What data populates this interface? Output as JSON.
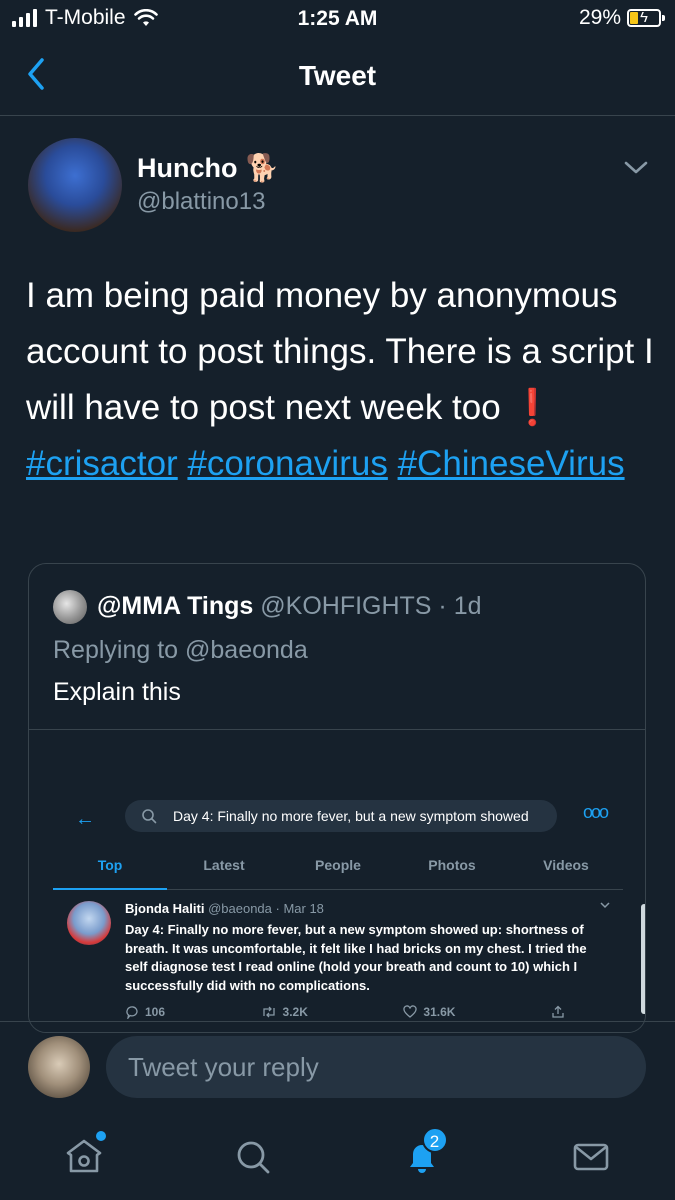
{
  "status_bar": {
    "carrier": "T-Mobile",
    "time": "1:25 AM",
    "battery": "29%",
    "battery_level": 0.29,
    "icons": [
      "signal-icon",
      "wifi-icon",
      "battery-charging-icon"
    ]
  },
  "nav": {
    "title": "Tweet",
    "back_icon": "chevron-left-icon"
  },
  "tweet": {
    "author_name": "Huncho",
    "author_emoji": "🐕",
    "author_handle": "@blattino13",
    "text_parts": {
      "line": "I am being paid money by anonymous account to post things. There is a script I will have to post next week too",
      "emoji": "❗",
      "hashtag1": "#crisactor",
      "hashtag2": "#coronavirus",
      "hashtag3": "#ChineseVirus"
    }
  },
  "quote": {
    "name": "@MMA Tings",
    "handle": "@KOHFIGHTS",
    "time": " · 1d",
    "replying": "Replying to @baeonda",
    "body": "Explain this",
    "screenshot": {
      "search_text": "Day 4: Finally no more fever, but a new symptom showed",
      "tabs": [
        "Top",
        "Latest",
        "People",
        "Photos",
        "Videos"
      ],
      "tweet_name": "Bjonda Haliti",
      "tweet_handle": "@baeonda",
      "tweet_date": " · Mar 18",
      "tweet_text": "Day 4: Finally no more fever, but a new symptom showed up: shortness of breath. It was uncomfortable, it felt like I had bricks on my chest. I tried the self diagnose test I read online (hold your breath and count to 10) which I successfully did with no complications.",
      "replies": "106",
      "retweets": "3.2K",
      "likes": "31.6K"
    }
  },
  "reply": {
    "placeholder": "Tweet your reply"
  },
  "tab_bar": {
    "notifications_badge": "2",
    "accent": "#1da1f2"
  }
}
